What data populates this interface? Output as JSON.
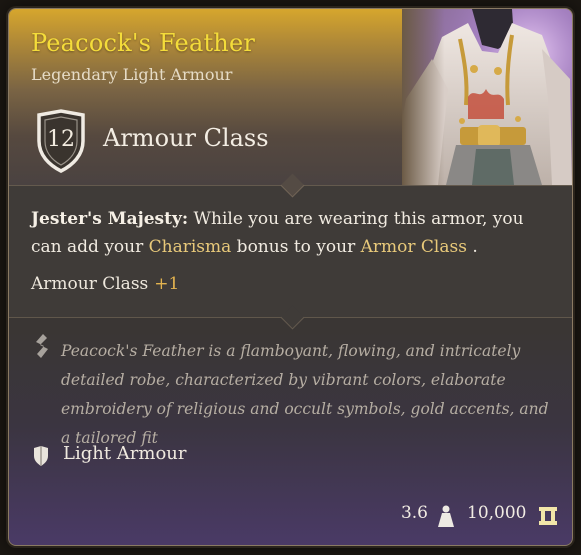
{
  "item": {
    "name": "Peacock's Feather",
    "type": "Legendary Light Armour",
    "rarity_color": "#f4dc3a"
  },
  "armour_class": {
    "value": "12",
    "label": "Armour Class"
  },
  "passive": {
    "name": "Jester's Majesty:",
    "text_before": " While you are wearing this armor, you can add your ",
    "keyword_1": "Charisma",
    "text_middle": " bonus to your ",
    "keyword_2": "Armor Class",
    "text_after": " ."
  },
  "bonus": {
    "label": "Armour Class",
    "value": "+1"
  },
  "description": {
    "text": "Peacock's Feather is a flamboyant, flowing, and intricately detailed robe, characterized by vibrant colors, elaborate embroidery of religious and occult symbols, gold accents, and a tailored fit"
  },
  "category": {
    "label": "Light Armour",
    "icon": "light-armour-icon"
  },
  "footer": {
    "weight": "3.6",
    "weight_icon": "weight-icon",
    "gold": "10,000",
    "gold_icon": "gold-coin-icon"
  },
  "colors": {
    "header_gold": "#d6a62d",
    "highlight": "#e8c97a",
    "bonus": "#e3b34f",
    "footer_purple": "#4a3a66"
  }
}
